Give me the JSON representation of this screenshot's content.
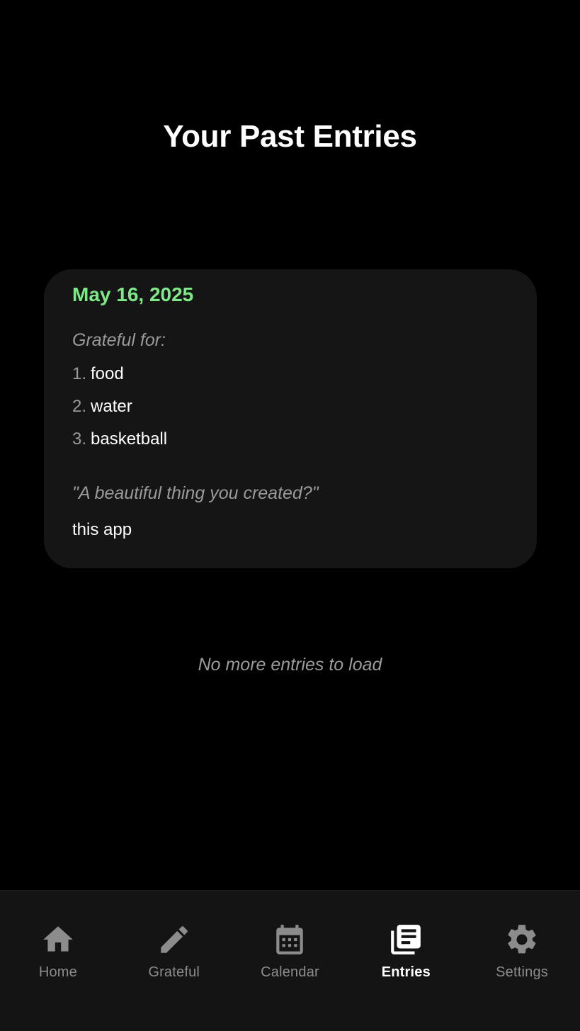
{
  "header": {
    "title": "Your Past Entries"
  },
  "entries": [
    {
      "date": "May 16, 2025",
      "grateful_label": "Grateful for:",
      "gratitudes": [
        {
          "number": "1.",
          "text": "food"
        },
        {
          "number": "2.",
          "text": "water"
        },
        {
          "number": "3.",
          "text": "basketball"
        }
      ],
      "prompt": "\"A beautiful thing you created?\"",
      "answer": "this app"
    }
  ],
  "footer_message": "No more entries to load",
  "tabs": [
    {
      "label": "Home",
      "icon": "home-icon",
      "active": false
    },
    {
      "label": "Grateful",
      "icon": "pencil-icon",
      "active": false
    },
    {
      "label": "Calendar",
      "icon": "calendar-icon",
      "active": false
    },
    {
      "label": "Entries",
      "icon": "entries-icon",
      "active": true
    },
    {
      "label": "Settings",
      "icon": "gear-icon",
      "active": false
    }
  ],
  "colors": {
    "background": "#000000",
    "card": "#151515",
    "accent_date": "#7ee787",
    "muted_text": "#9a9a9a",
    "tab_bar": "#141414",
    "tab_inactive": "#8c8c8c",
    "tab_active": "#ffffff"
  }
}
